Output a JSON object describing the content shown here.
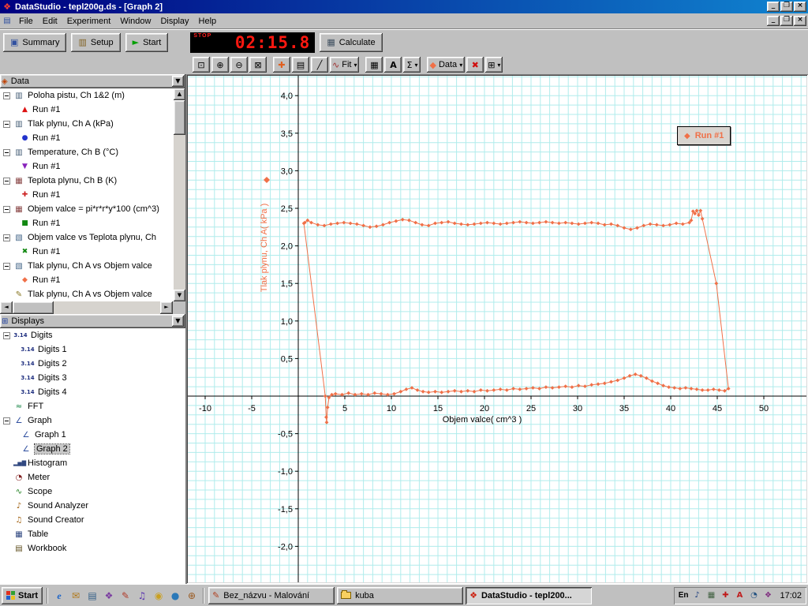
{
  "titlebar": {
    "title": "DataStudio - tepl200g.ds - [Graph 2]"
  },
  "menubar": {
    "items": [
      "File",
      "Edit",
      "Experiment",
      "Window",
      "Display",
      "Help"
    ]
  },
  "main_toolbar": {
    "summary_label": "Summary",
    "setup_label": "Setup",
    "start_label": "Start",
    "calculate_label": "Calculate",
    "timer_stop_label": "STOP",
    "timer_value": "02:15.8"
  },
  "graph_toolbar": {
    "fit_label": "Fit",
    "stats_label": "Σ",
    "data_label": "Data",
    "text_label": "A"
  },
  "data_panel": {
    "header_label": "Data",
    "items": [
      {
        "label": "Poloha pistu, Ch 1&2 (m)",
        "icon": "▥",
        "icon_color": "#486078",
        "run_label": "Run #1",
        "run_glyph": "▲",
        "run_color": "#dd1111"
      },
      {
        "label": "Tlak plynu, Ch A (kPa)",
        "icon": "▥",
        "icon_color": "#486078",
        "run_label": "Run #1",
        "run_glyph": "●",
        "run_color": "#2233cc"
      },
      {
        "label": "Temperature, Ch B (°C)",
        "icon": "▥",
        "icon_color": "#486078",
        "run_label": "Run #1",
        "run_glyph": "▼",
        "run_color": "#8822bb"
      },
      {
        "label": "Teplota plynu, Ch B (K)",
        "icon": "▦",
        "icon_color": "#884444",
        "run_label": "Run #1",
        "run_glyph": "✚",
        "run_color": "#cc2222"
      },
      {
        "label": "Objem valce = pi*r*r*y*100 (cm^3)",
        "icon": "▦",
        "icon_color": "#884444",
        "run_label": "Run #1",
        "run_glyph": "■",
        "run_color": "#118811"
      },
      {
        "label": "Objem valce vs Teplota plynu, Ch",
        "icon": "▧",
        "icon_color": "#446688",
        "run_label": "Run #1",
        "run_glyph": "✖",
        "run_color": "#118811"
      },
      {
        "label": "Tlak plynu, Ch A vs Objem valce",
        "icon": "▧",
        "icon_color": "#446688",
        "run_label": "Run #1",
        "run_glyph": "◆",
        "run_color": "#f07048"
      },
      {
        "label": "Tlak plynu, Ch A vs Objem valce",
        "icon": "✎",
        "icon_color": "#887722"
      }
    ]
  },
  "displays_panel": {
    "header_label": "Displays",
    "digits": {
      "label": "Digits",
      "icon": "3.14",
      "children": [
        "Digits 1",
        "Digits 2",
        "Digits 3",
        "Digits 4"
      ]
    },
    "fft": {
      "label": "FFT",
      "icon": "≈",
      "color": "#108040"
    },
    "graph": {
      "label": "Graph",
      "icon": "∠",
      "color": "#3050a0",
      "children": [
        "Graph 1",
        "Graph 2"
      ],
      "selected": "Graph 2"
    },
    "histogram": {
      "label": "Histogram",
      "icon": "▂▅▇",
      "color": "#304880"
    },
    "meter": {
      "label": "Meter",
      "icon": "◔",
      "color": "#802020"
    },
    "scope": {
      "label": "Scope",
      "icon": "∿",
      "color": "#208020"
    },
    "sound_analyzer": {
      "label": "Sound Analyzer",
      "icon": "♪",
      "color": "#a06010"
    },
    "sound_creator": {
      "label": "Sound Creator",
      "icon": "♫",
      "color": "#a06010"
    },
    "table": {
      "label": "Table",
      "icon": "▦",
      "color": "#304880"
    },
    "workbook": {
      "label": "Workbook",
      "icon": "▤",
      "color": "#605020"
    }
  },
  "taskbar": {
    "start_label": "Start",
    "quicklaunch": [
      {
        "name": "ie",
        "glyph": "e",
        "color": "#1b64c8"
      },
      {
        "name": "outlook",
        "glyph": "✉",
        "color": "#b07818"
      },
      {
        "name": "desktop",
        "glyph": "▤",
        "color": "#356088"
      },
      {
        "name": "channels",
        "glyph": "❖",
        "color": "#7a3ba0"
      },
      {
        "name": "paint",
        "glyph": "✎",
        "color": "#b03a2a"
      },
      {
        "name": "media",
        "glyph": "♫",
        "color": "#5b35b0"
      },
      {
        "name": "cd",
        "glyph": "◉",
        "color": "#caa020"
      },
      {
        "name": "globe",
        "glyph": "●",
        "color": "#2a78b8"
      },
      {
        "name": "java",
        "glyph": "⊕",
        "color": "#9a5a20"
      }
    ],
    "tasks": [
      {
        "label": "Bez_názvu - Malování",
        "glyph": "✎",
        "color": "#b04020"
      },
      {
        "label": "kuba"
      },
      {
        "label": "DataStudio - tepl200...",
        "glyph": "❖",
        "color": "#cc2210"
      }
    ],
    "tray": {
      "lang": "En",
      "time": "17:02",
      "icons": [
        {
          "name": "volume",
          "glyph": "♪",
          "color": "#204080"
        },
        {
          "name": "display",
          "glyph": "▦",
          "color": "#406040"
        },
        {
          "name": "antivirus",
          "glyph": "✚",
          "color": "#c01818"
        },
        {
          "name": "ati",
          "glyph": "A",
          "color": "#c02020"
        },
        {
          "name": "scheduler",
          "glyph": "◔",
          "color": "#205080"
        },
        {
          "name": "updates",
          "glyph": "❖",
          "color": "#803080"
        }
      ]
    }
  },
  "chart_data": {
    "type": "line",
    "title": "",
    "xlabel": "Objem valce( cm^3 )",
    "ylabel": "Tlak plynu, Ch A( kPa )",
    "xlim": [
      -11.9,
      54.6
    ],
    "ylim": [
      -2.48,
      4.27
    ],
    "x_ticks": [
      {
        "v": -10,
        "label": "-10"
      },
      {
        "v": -5,
        "label": "-5"
      },
      {
        "v": 5,
        "label": "5"
      },
      {
        "v": 10,
        "label": "10"
      },
      {
        "v": 15,
        "label": "15"
      },
      {
        "v": 20,
        "label": "20"
      },
      {
        "v": 25,
        "label": "25"
      },
      {
        "v": 30,
        "label": "30"
      },
      {
        "v": 35,
        "label": "35"
      },
      {
        "v": 40,
        "label": "40"
      },
      {
        "v": 45,
        "label": "45"
      },
      {
        "v": 50,
        "label": "50"
      }
    ],
    "y_ticks": [
      {
        "v": 4,
        "label": "4,0"
      },
      {
        "v": 3.5,
        "label": "3,5"
      },
      {
        "v": 3,
        "label": "3,0"
      },
      {
        "v": 2.5,
        "label": "2,5"
      },
      {
        "v": 2,
        "label": "2,0"
      },
      {
        "v": 1.5,
        "label": "1,5"
      },
      {
        "v": 1,
        "label": "1,0"
      },
      {
        "v": 0.5,
        "label": "0,5"
      },
      {
        "v": -0.5,
        "label": "-0,5"
      },
      {
        "v": -1,
        "label": "-1,0"
      },
      {
        "v": -1.5,
        "label": "-1,5"
      },
      {
        "v": -2,
        "label": "-2,0"
      }
    ],
    "grid": {
      "on": true,
      "color": "#b0ecec",
      "pitch_x_units": 1,
      "pitch_y_units": 0.125
    },
    "legend": {
      "label": "Run #1",
      "glyph": "◆",
      "position": "top-right"
    },
    "series": [
      {
        "name": "Run #1",
        "color": "#f07048",
        "points": [
          [
            0.6,
            2.3
          ],
          [
            2.9,
            0.0
          ],
          [
            3.0,
            -0.28
          ],
          [
            3.05,
            -0.35
          ],
          [
            3.15,
            -0.15
          ],
          [
            3.3,
            -0.02
          ],
          [
            3.6,
            0.02
          ],
          [
            4.0,
            0.03
          ],
          [
            4.7,
            0.02
          ],
          [
            5.4,
            0.04
          ],
          [
            6.1,
            0.02
          ],
          [
            6.8,
            0.03
          ],
          [
            7.5,
            0.02
          ],
          [
            8.2,
            0.04
          ],
          [
            8.9,
            0.03
          ],
          [
            9.6,
            0.02
          ],
          [
            10.3,
            0.03
          ],
          [
            11.0,
            0.06
          ],
          [
            11.6,
            0.09
          ],
          [
            12.2,
            0.11
          ],
          [
            12.8,
            0.08
          ],
          [
            13.4,
            0.06
          ],
          [
            14.0,
            0.05
          ],
          [
            14.7,
            0.06
          ],
          [
            15.4,
            0.05
          ],
          [
            16.1,
            0.06
          ],
          [
            16.8,
            0.07
          ],
          [
            17.5,
            0.06
          ],
          [
            18.2,
            0.07
          ],
          [
            18.9,
            0.06
          ],
          [
            19.6,
            0.08
          ],
          [
            20.3,
            0.07
          ],
          [
            21.0,
            0.08
          ],
          [
            21.7,
            0.09
          ],
          [
            22.4,
            0.08
          ],
          [
            23.1,
            0.1
          ],
          [
            23.8,
            0.09
          ],
          [
            24.5,
            0.1
          ],
          [
            25.2,
            0.11
          ],
          [
            25.9,
            0.1
          ],
          [
            26.6,
            0.12
          ],
          [
            27.3,
            0.11
          ],
          [
            28.0,
            0.12
          ],
          [
            28.7,
            0.13
          ],
          [
            29.4,
            0.12
          ],
          [
            30.1,
            0.14
          ],
          [
            30.8,
            0.13
          ],
          [
            31.5,
            0.15
          ],
          [
            32.2,
            0.16
          ],
          [
            32.9,
            0.17
          ],
          [
            33.6,
            0.19
          ],
          [
            34.3,
            0.21
          ],
          [
            35.0,
            0.24
          ],
          [
            35.6,
            0.27
          ],
          [
            36.2,
            0.29
          ],
          [
            36.8,
            0.27
          ],
          [
            37.4,
            0.24
          ],
          [
            38.0,
            0.2
          ],
          [
            38.6,
            0.17
          ],
          [
            39.2,
            0.14
          ],
          [
            39.8,
            0.12
          ],
          [
            40.4,
            0.11
          ],
          [
            41.0,
            0.1
          ],
          [
            41.6,
            0.11
          ],
          [
            42.2,
            0.1
          ],
          [
            42.8,
            0.09
          ],
          [
            43.4,
            0.08
          ],
          [
            44.0,
            0.08
          ],
          [
            44.6,
            0.09
          ],
          [
            45.2,
            0.08
          ],
          [
            45.8,
            0.07
          ],
          [
            46.2,
            0.1
          ],
          [
            44.9,
            1.5
          ],
          [
            43.4,
            2.36
          ],
          [
            43.2,
            2.47
          ],
          [
            43.0,
            2.41
          ],
          [
            42.8,
            2.47
          ],
          [
            42.6,
            2.43
          ],
          [
            42.4,
            2.46
          ],
          [
            42.2,
            2.34
          ],
          [
            42.0,
            2.31
          ],
          [
            41.3,
            2.29
          ],
          [
            40.6,
            2.3
          ],
          [
            39.9,
            2.28
          ],
          [
            39.2,
            2.27
          ],
          [
            38.5,
            2.28
          ],
          [
            37.8,
            2.29
          ],
          [
            37.1,
            2.27
          ],
          [
            36.4,
            2.24
          ],
          [
            35.7,
            2.22
          ],
          [
            35.0,
            2.24
          ],
          [
            34.3,
            2.27
          ],
          [
            33.6,
            2.29
          ],
          [
            32.9,
            2.28
          ],
          [
            32.2,
            2.3
          ],
          [
            31.5,
            2.31
          ],
          [
            30.8,
            2.3
          ],
          [
            30.1,
            2.29
          ],
          [
            29.4,
            2.3
          ],
          [
            28.7,
            2.31
          ],
          [
            28.0,
            2.3
          ],
          [
            27.3,
            2.31
          ],
          [
            26.6,
            2.32
          ],
          [
            25.9,
            2.31
          ],
          [
            25.2,
            2.3
          ],
          [
            24.5,
            2.31
          ],
          [
            23.8,
            2.32
          ],
          [
            23.1,
            2.31
          ],
          [
            22.4,
            2.3
          ],
          [
            21.7,
            2.29
          ],
          [
            21.0,
            2.3
          ],
          [
            20.3,
            2.31
          ],
          [
            19.6,
            2.3
          ],
          [
            18.9,
            2.29
          ],
          [
            18.2,
            2.28
          ],
          [
            17.5,
            2.29
          ],
          [
            16.8,
            2.3
          ],
          [
            16.1,
            2.32
          ],
          [
            15.4,
            2.31
          ],
          [
            14.7,
            2.3
          ],
          [
            14.0,
            2.27
          ],
          [
            13.3,
            2.28
          ],
          [
            12.6,
            2.31
          ],
          [
            11.9,
            2.34
          ],
          [
            11.2,
            2.35
          ],
          [
            10.5,
            2.33
          ],
          [
            9.8,
            2.31
          ],
          [
            9.1,
            2.28
          ],
          [
            8.4,
            2.26
          ],
          [
            7.7,
            2.25
          ],
          [
            7.0,
            2.27
          ],
          [
            6.3,
            2.29
          ],
          [
            5.6,
            2.3
          ],
          [
            4.9,
            2.31
          ],
          [
            4.2,
            2.3
          ],
          [
            3.5,
            2.29
          ],
          [
            2.8,
            2.27
          ],
          [
            2.1,
            2.28
          ],
          [
            1.4,
            2.31
          ],
          [
            1.0,
            2.34
          ],
          [
            0.7,
            2.31
          ],
          [
            0.6,
            2.3
          ]
        ]
      }
    ]
  }
}
